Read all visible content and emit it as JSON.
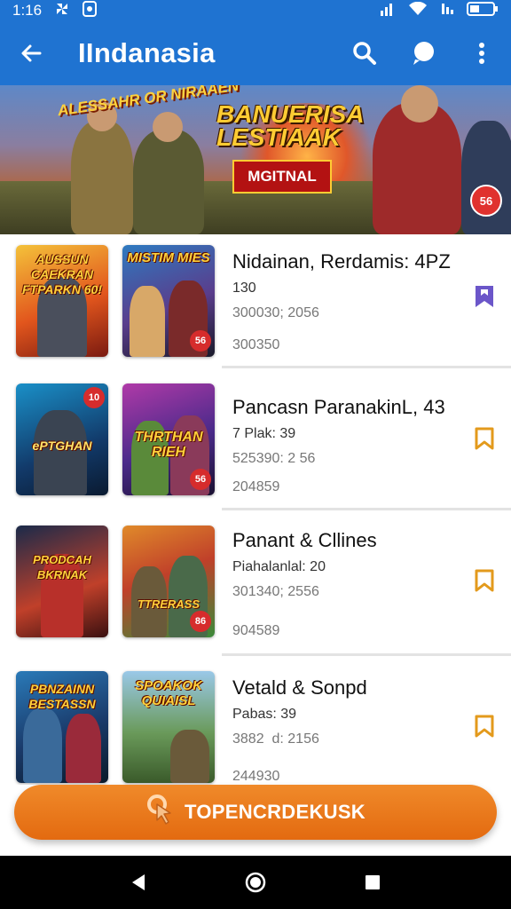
{
  "status_bar": {
    "time": "1:16"
  },
  "app_bar": {
    "title": "IIndanasia",
    "back_icon": "arrow-back-icon",
    "actions": [
      "search-icon",
      "chat-bubble-icon",
      "more-vert-icon"
    ]
  },
  "hero": {
    "tag_text": "ALESSAHR OR NIRAAEN",
    "title": "BANUERISA LESTIAAK",
    "subtitle": "MGITNAL",
    "badge": "56"
  },
  "items": [
    {
      "title": "Nidainan, Rerdamis: 4PZ",
      "line1": "130",
      "line2": "300030; 2056",
      "line3": "300350",
      "bookmark_color": "#6b56c9",
      "bookmark_filled": true,
      "thumb_a": {
        "label": "AUSSUN CAEKRAN FTPARKN 60!",
        "badge": ""
      },
      "thumb_b": {
        "label": "MISTIM MIES",
        "badge": "56"
      }
    },
    {
      "title": "Pancasn ParanakinL, 43",
      "line1": "7 Plak: 39",
      "line2": "525390: 2 56",
      "line3": "204859",
      "bookmark_color": "#e39a1c",
      "bookmark_filled": false,
      "thumb_a": {
        "label": "ePTGHAN",
        "badge": "10"
      },
      "thumb_b": {
        "label": "THRTHAN RIEH",
        "badge": "56"
      }
    },
    {
      "title": "Panant & Cllines",
      "line1": "Piahalanlal: 20",
      "line2": "301340; 2556",
      "line3": "904589",
      "bookmark_color": "#e39a1c",
      "bookmark_filled": false,
      "thumb_a": {
        "label": "PRODCAH BKRNAK",
        "badge": ""
      },
      "thumb_b": {
        "label": "TTRERASS",
        "badge": "86"
      }
    },
    {
      "title": "Vetald & Sonpd",
      "line1": "Pabas: 39",
      "line2": "3882  d: 2156",
      "line3": "244930",
      "bookmark_color": "#e39a1c",
      "bookmark_filled": false,
      "thumb_a": {
        "label": "PBNZAINN BESTASSN",
        "badge": ""
      },
      "thumb_b": {
        "label": "SPOAKOK QUIAISL",
        "badge": ""
      }
    }
  ],
  "cta": {
    "label": "TOPENCRDEKUSK",
    "icon": "tap-hand-icon"
  },
  "nav_bar": [
    "back-triangle-icon",
    "home-circle-icon",
    "recents-square-icon"
  ]
}
